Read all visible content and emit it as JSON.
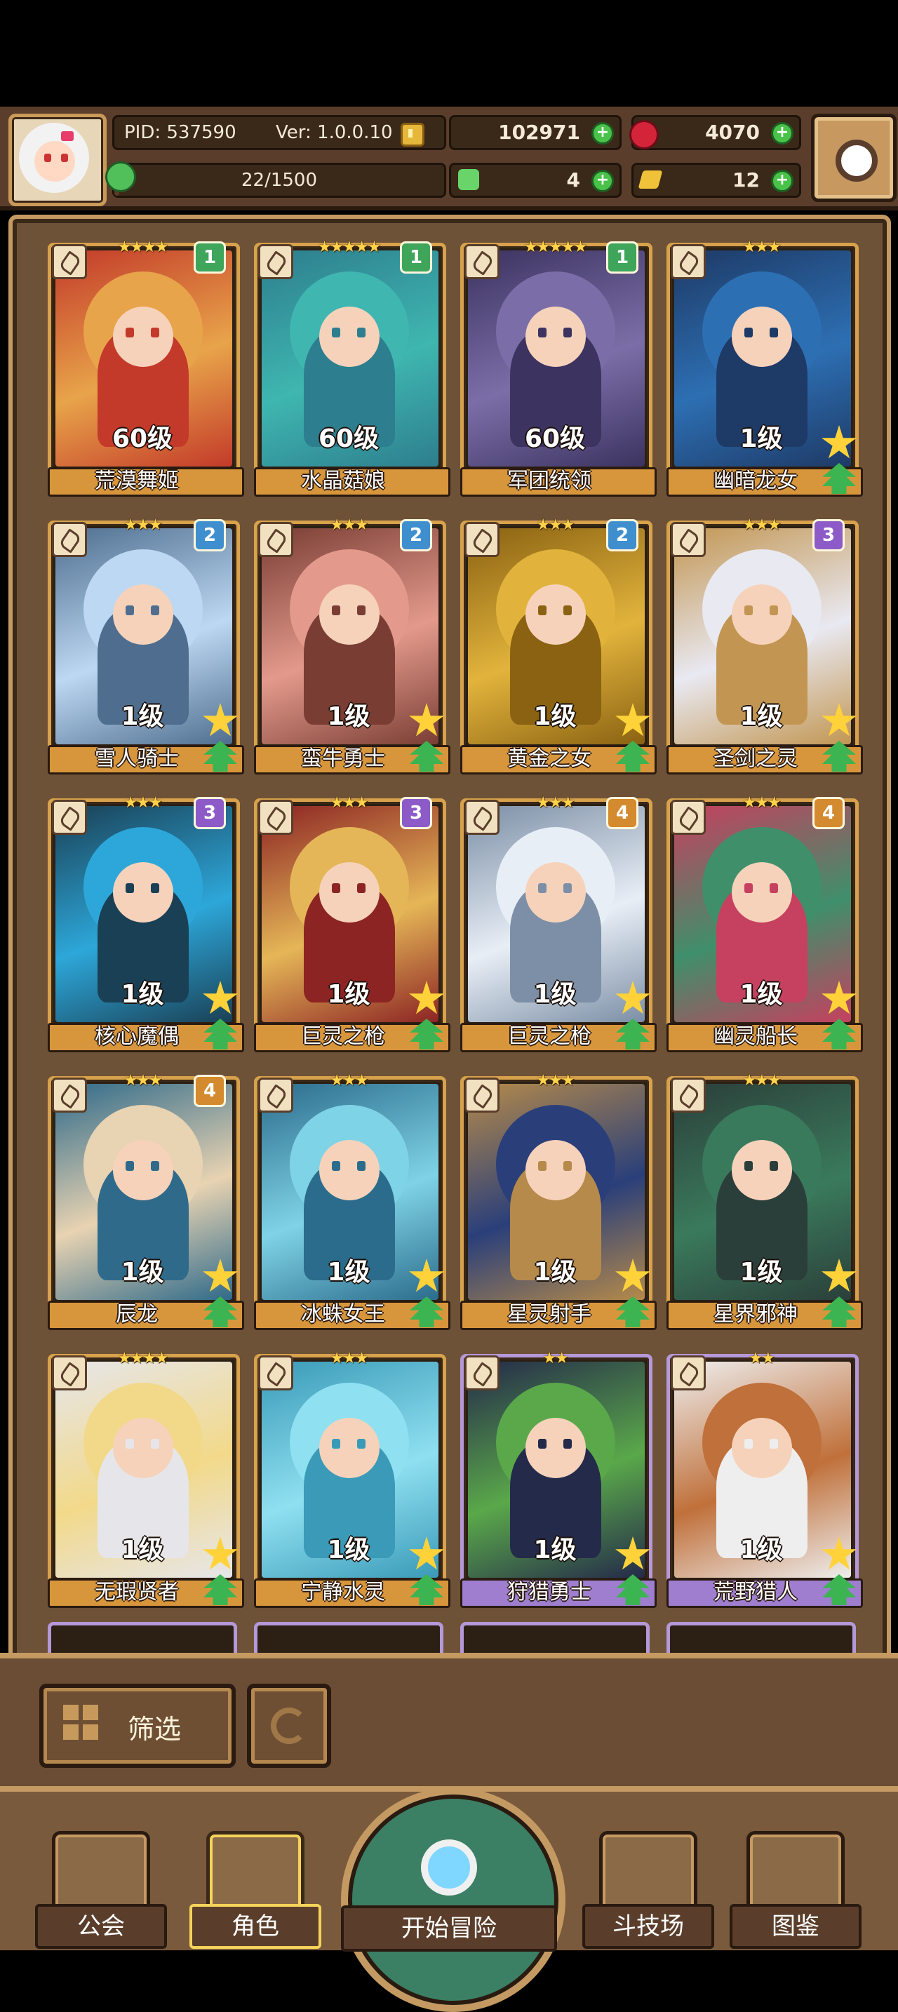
{
  "header": {
    "pid": "PID: 537590",
    "version": "Ver: 1.0.0.10",
    "xp": "22/1500",
    "xp_progress": 0.0147,
    "coins": "102971",
    "gems": "4070",
    "clovers": "4",
    "keys": "12",
    "icons": {
      "coin": "coin-icon",
      "gem": "red-gem-icon",
      "clover": "clover-icon",
      "key": "key-icon",
      "settings": "gear-icon"
    }
  },
  "colors": {
    "gold_frame": "#d8a24c",
    "purple_frame": "#b598d8",
    "badge_green": "#3ea55b",
    "badge_blue": "#3f8fcf",
    "badge_purple": "#8d5bc8",
    "badge_orange": "#d48a2e"
  },
  "cards": [
    {
      "name": "荒漠舞姬",
      "level": "60级",
      "stars": "★★★★",
      "badge": "1",
      "badge_color": "#3ea55b",
      "frame": "gold",
      "palette": [
        "#e8a44a",
        "#c33a2a"
      ],
      "upgradeable": false
    },
    {
      "name": "水晶菇娘",
      "level": "60级",
      "stars": "★★★★★",
      "badge": "1",
      "badge_color": "#3ea55b",
      "frame": "gold",
      "palette": [
        "#3fb6b0",
        "#2d7e8e"
      ],
      "upgradeable": false
    },
    {
      "name": "军团统领",
      "level": "60级",
      "stars": "★★★★★",
      "badge": "1",
      "badge_color": "#3ea55b",
      "frame": "gold",
      "palette": [
        "#7b6ea8",
        "#3c3360"
      ],
      "upgradeable": false
    },
    {
      "name": "幽暗龙女",
      "level": "1级",
      "stars": "★★★",
      "badge": "",
      "badge_color": "",
      "frame": "gold",
      "palette": [
        "#2d6fb3",
        "#1e3a66"
      ],
      "upgradeable": true
    },
    {
      "name": "雪人骑士",
      "level": "1级",
      "stars": "★★★",
      "badge": "2",
      "badge_color": "#3f8fcf",
      "frame": "gold",
      "palette": [
        "#bcd8f2",
        "#4f6e8f"
      ],
      "upgradeable": true
    },
    {
      "name": "蛮牛勇士",
      "level": "1级",
      "stars": "★★★",
      "badge": "2",
      "badge_color": "#3f8fcf",
      "frame": "gold",
      "palette": [
        "#e39a8c",
        "#7a3d34"
      ],
      "upgradeable": true
    },
    {
      "name": "黄金之女",
      "level": "1级",
      "stars": "★★★",
      "badge": "2",
      "badge_color": "#3f8fcf",
      "frame": "gold",
      "palette": [
        "#e2b33c",
        "#8a6212"
      ],
      "upgradeable": true
    },
    {
      "name": "圣剑之灵",
      "level": "1级",
      "stars": "★★★",
      "badge": "3",
      "badge_color": "#8d5bc8",
      "frame": "gold",
      "palette": [
        "#e9e9f2",
        "#c29652"
      ],
      "upgradeable": true
    },
    {
      "name": "核心魔偶",
      "level": "1级",
      "stars": "★★★",
      "badge": "3",
      "badge_color": "#8d5bc8",
      "frame": "gold",
      "palette": [
        "#2da7d9",
        "#1a4055"
      ],
      "upgradeable": true
    },
    {
      "name": "巨灵之枪",
      "level": "1级",
      "stars": "★★★",
      "badge": "3",
      "badge_color": "#8d5bc8",
      "frame": "gold",
      "palette": [
        "#e5b657",
        "#8c2424"
      ],
      "upgradeable": true
    },
    {
      "name": "巨灵之枪",
      "level": "1级",
      "stars": "★★★",
      "badge": "4",
      "badge_color": "#d48a2e",
      "frame": "gold",
      "palette": [
        "#e8eef6",
        "#7c8fa6"
      ],
      "upgradeable": true
    },
    {
      "name": "幽灵船长",
      "level": "1级",
      "stars": "★★★",
      "badge": "4",
      "badge_color": "#d48a2e",
      "frame": "gold",
      "palette": [
        "#3f8f6b",
        "#c6405f"
      ],
      "upgradeable": true
    },
    {
      "name": "辰龙",
      "level": "1级",
      "stars": "★★★",
      "badge": "4",
      "badge_color": "#d48a2e",
      "frame": "gold",
      "palette": [
        "#e8d3b2",
        "#2f6a8a"
      ],
      "upgradeable": true
    },
    {
      "name": "冰蛛女王",
      "level": "1级",
      "stars": "★★★",
      "badge": "",
      "badge_color": "",
      "frame": "gold",
      "palette": [
        "#7fd3e6",
        "#2b6c8c"
      ],
      "upgradeable": true
    },
    {
      "name": "星灵射手",
      "level": "1级",
      "stars": "★★★",
      "badge": "",
      "badge_color": "",
      "frame": "gold",
      "palette": [
        "#2a3f7a",
        "#b58a4a"
      ],
      "upgradeable": true
    },
    {
      "name": "星界邪神",
      "level": "1级",
      "stars": "★★★",
      "badge": "",
      "badge_color": "",
      "frame": "gold",
      "palette": [
        "#3a7a5c",
        "#2b3f3a"
      ],
      "upgradeable": true
    },
    {
      "name": "无瑕贤者",
      "level": "1级",
      "stars": "★★★★",
      "badge": "",
      "badge_color": "",
      "frame": "gold",
      "palette": [
        "#f2d98a",
        "#e6e6ea"
      ],
      "upgradeable": true
    },
    {
      "name": "宁静水灵",
      "level": "1级",
      "stars": "★★★",
      "badge": "",
      "badge_color": "",
      "frame": "gold",
      "palette": [
        "#8fe0f0",
        "#3a9ab8"
      ],
      "upgradeable": true
    },
    {
      "name": "狩猎勇士",
      "level": "1级",
      "stars": "★★",
      "badge": "",
      "badge_color": "",
      "frame": "purple",
      "palette": [
        "#5aa84a",
        "#242a4a"
      ],
      "upgradeable": true
    },
    {
      "name": "荒野猎人",
      "level": "1级",
      "stars": "★★",
      "badge": "",
      "badge_color": "",
      "frame": "purple",
      "palette": [
        "#c0703a",
        "#eeeeee"
      ],
      "upgradeable": true
    }
  ],
  "filter": {
    "label": "筛选"
  },
  "nav": {
    "guild": "公会",
    "characters": "角色",
    "adventure": "开始冒险",
    "arena": "斗技场",
    "codex": "图鉴"
  }
}
